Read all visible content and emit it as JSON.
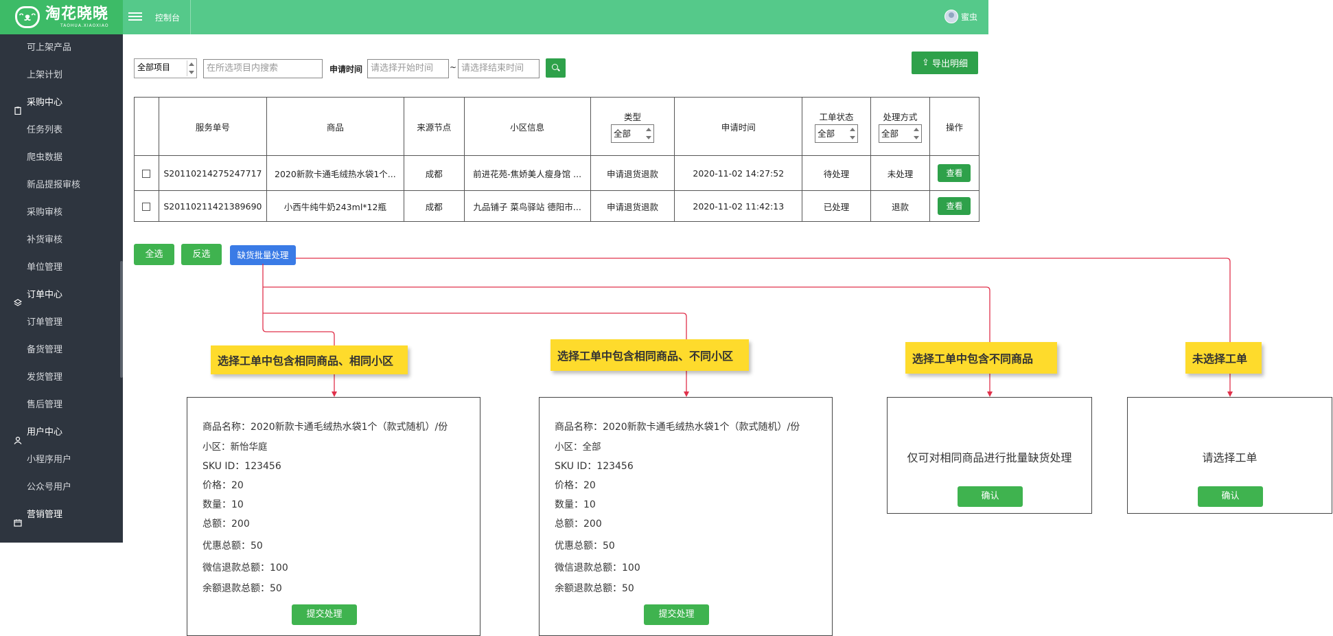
{
  "app": {
    "logo_cn": "淘花晓晓",
    "logo_en": "TAOHUA.XIAOXIAO",
    "breadcrumb": "控制台",
    "user_name": "蜜虫"
  },
  "sidebar": {
    "items": [
      {
        "label": "可上架产品",
        "group": false
      },
      {
        "label": "上架计划",
        "group": false
      },
      {
        "label": "采购中心",
        "group": true,
        "icon": "clipboard-icon"
      },
      {
        "label": "任务列表",
        "group": false
      },
      {
        "label": "爬虫数据",
        "group": false
      },
      {
        "label": "新品提报审核",
        "group": false
      },
      {
        "label": "采购审核",
        "group": false
      },
      {
        "label": "补货审核",
        "group": false
      },
      {
        "label": "单位管理",
        "group": false
      },
      {
        "label": "订单中心",
        "group": true,
        "icon": "layers-icon"
      },
      {
        "label": "订单管理",
        "group": false
      },
      {
        "label": "备货管理",
        "group": false
      },
      {
        "label": "发货管理",
        "group": false
      },
      {
        "label": "售后管理",
        "group": false
      },
      {
        "label": "用户中心",
        "group": true,
        "icon": "user-icon"
      },
      {
        "label": "小程序用户",
        "group": false
      },
      {
        "label": "公众号用户",
        "group": false
      },
      {
        "label": "营销管理",
        "group": true,
        "icon": "calendar-icon"
      }
    ]
  },
  "filters": {
    "project_select": "全部项目",
    "search_placeholder": "在所选项目内搜索",
    "date_label": "申请时间",
    "start_placeholder": "请选择开始时间",
    "range_sep": "~",
    "end_placeholder": "请选择结束时间",
    "export_label": "导出明细"
  },
  "table": {
    "headers": [
      "",
      "服务单号",
      "商品",
      "来源节点",
      "小区信息",
      "类型",
      "申请时间",
      "工单状态",
      "处理方式",
      "操作"
    ],
    "type_filter": "全部",
    "status_filter": "全部",
    "method_filter": "全部",
    "rows": [
      {
        "id": "S20110214275247717",
        "product": "2020新款卡通毛绒热水袋1个...",
        "source": "成都",
        "community": "前进花苑-焦娇美人瘦身馆 ...",
        "type": "申请退货退款",
        "time": "2020-11-02 14:27:52",
        "status": "待处理",
        "method": "未处理",
        "action": "查看"
      },
      {
        "id": "S20110211421389690",
        "product": "小西牛纯牛奶243ml*12瓶",
        "source": "成都",
        "community": "九品铺子 菜鸟驿站 德阳市...",
        "type": "申请退货退款",
        "time": "2020-11-02 11:42:13",
        "status": "已处理",
        "method": "退款",
        "action": "查看"
      }
    ]
  },
  "actions": {
    "select_all": "全选",
    "invert": "反选",
    "batch": "缺货批量处理"
  },
  "notes": [
    "选择工单中包含相同商品、相同小区",
    "选择工单中包含相同商品、不同小区",
    "选择工单中包含不同商品",
    "未选择工单"
  ],
  "panel_same": {
    "lines": [
      "商品名称：2020新款卡通毛绒热水袋1个（款式随机）/份",
      "小区：新怡华庭",
      "SKU ID：123456",
      "价格：20",
      "数量：10",
      "总额：200",
      "优惠总额：50",
      "微信退款总额：100",
      "余额退款总额：50"
    ],
    "button": "提交处理"
  },
  "panel_diff": {
    "lines": [
      "商品名称：2020新款卡通毛绒热水袋1个（款式随机）/份",
      "小区：全部",
      "SKU ID：123456",
      "价格：20",
      "数量：10",
      "总额：200",
      "优惠总额：50",
      "微信退款总额：100",
      "余额退款总额：50"
    ],
    "button": "提交处理"
  },
  "panel_mixed": {
    "message": "仅可对相同商品进行批量缺货处理",
    "button": "确认"
  },
  "panel_none": {
    "message": "请选择工单",
    "button": "确认"
  },
  "colors": {
    "header_green": "#55c98a",
    "logo_green": "#3dbb67",
    "button_green": "#3fb34f",
    "primary_blue": "#3a7be6",
    "sidebar_bg": "#2e353f",
    "note_yellow": "#fedb2c",
    "line_red": "#e0304a"
  }
}
